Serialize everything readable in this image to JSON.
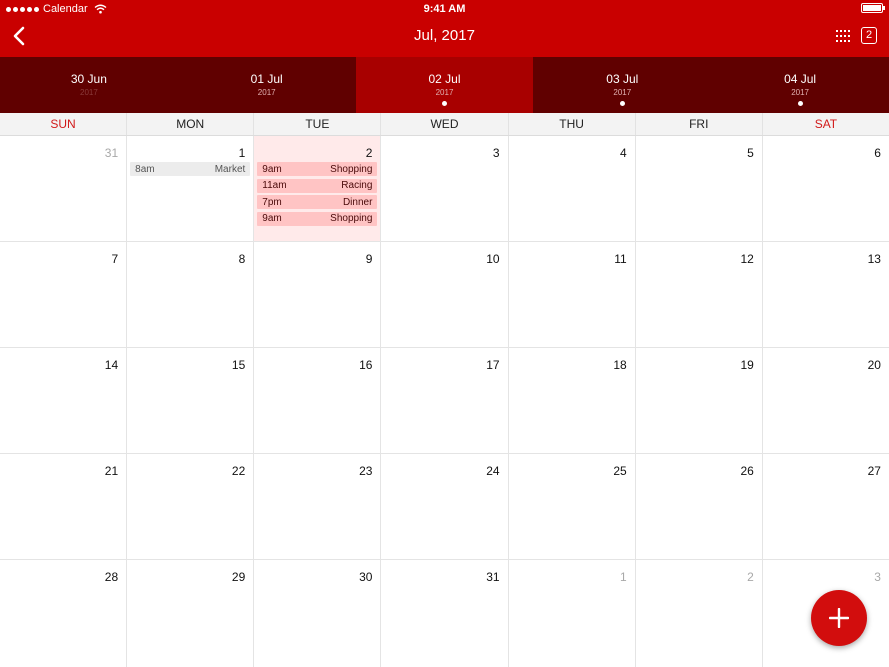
{
  "status_bar": {
    "app_name": "Calendar",
    "time": "9:41 AM",
    "battery_level": 1.0
  },
  "header": {
    "title": "Jul, 2017",
    "badge_count": "2",
    "back_icon": "chevron-left-icon",
    "grid_icon": "grid-icon"
  },
  "date_strip": [
    {
      "date": "30 Jun",
      "year": "2017",
      "selected": false,
      "has_events": false
    },
    {
      "date": "01 Jul",
      "year": "2017",
      "selected": false,
      "has_events": false
    },
    {
      "date": "02 Jul",
      "year": "2017",
      "selected": true,
      "has_events": true
    },
    {
      "date": "03 Jul",
      "year": "2017",
      "selected": false,
      "has_events": true
    },
    {
      "date": "04 Jul",
      "year": "2017",
      "selected": false,
      "has_events": true
    }
  ],
  "weekdays": [
    "SUN",
    "MON",
    "TUE",
    "WED",
    "THU",
    "FRI",
    "SAT"
  ],
  "weeks": [
    [
      {
        "day": "31",
        "other": true
      },
      {
        "day": "1",
        "events": [
          {
            "time": "8am",
            "title": "Market",
            "style": "grey"
          }
        ]
      },
      {
        "day": "2",
        "today": true,
        "events": [
          {
            "time": "9am",
            "title": "Shopping"
          },
          {
            "time": "11am",
            "title": "Racing"
          },
          {
            "time": "7pm",
            "title": "Dinner"
          },
          {
            "time": "9am",
            "title": "Shopping"
          }
        ]
      },
      {
        "day": "3"
      },
      {
        "day": "4"
      },
      {
        "day": "5"
      },
      {
        "day": "6"
      }
    ],
    [
      {
        "day": "7"
      },
      {
        "day": "8"
      },
      {
        "day": "9"
      },
      {
        "day": "10"
      },
      {
        "day": "11"
      },
      {
        "day": "12"
      },
      {
        "day": "13"
      }
    ],
    [
      {
        "day": "14"
      },
      {
        "day": "15"
      },
      {
        "day": "16"
      },
      {
        "day": "17"
      },
      {
        "day": "18"
      },
      {
        "day": "19"
      },
      {
        "day": "20"
      }
    ],
    [
      {
        "day": "21"
      },
      {
        "day": "22"
      },
      {
        "day": "23"
      },
      {
        "day": "24"
      },
      {
        "day": "25"
      },
      {
        "day": "26"
      },
      {
        "day": "27"
      }
    ],
    [
      {
        "day": "28"
      },
      {
        "day": "29"
      },
      {
        "day": "30"
      },
      {
        "day": "31"
      },
      {
        "day": "1",
        "other": true
      },
      {
        "day": "2",
        "other": true
      },
      {
        "day": "3",
        "other": true
      }
    ]
  ],
  "fab": {
    "icon": "plus-icon"
  },
  "colors": {
    "header": "#c90000",
    "strip": "#600000",
    "strip_selected": "#a80000",
    "weekend_label": "#d21a1a",
    "today_bg": "#ffeaea",
    "event_bg": "#ffc4c4",
    "fab": "#d20d0d"
  }
}
